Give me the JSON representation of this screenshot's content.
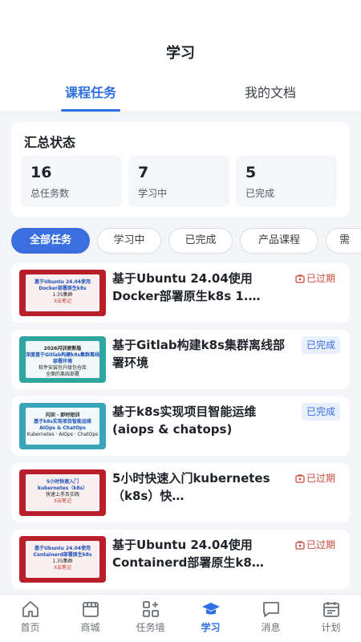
{
  "header": {
    "title": "学习",
    "tabs": [
      {
        "label": "课程任务",
        "active": true
      },
      {
        "label": "我的文档",
        "active": false
      }
    ]
  },
  "summary": {
    "title": "汇总状态",
    "stats": [
      {
        "value": "16",
        "label": "总任务数"
      },
      {
        "value": "7",
        "label": "学习中"
      },
      {
        "value": "5",
        "label": "已完成"
      }
    ]
  },
  "filters": {
    "chips": [
      "全部任务",
      "学习中",
      "已完成",
      "产品课程",
      "需"
    ],
    "active": "全部任务"
  },
  "courses": [
    {
      "title": "基于Ubuntu 24.04使用Docker部署原生k8s 1.…",
      "status": "已过期",
      "status_type": "expired",
      "thumb": {
        "line1": "基于Ubuntu 24.04使用",
        "line2": "Docker部署原生k8s",
        "line3": "1.35集群",
        "line4": "X云笔记",
        "bg": "#b81f2a"
      }
    },
    {
      "title": "基于Gitlab构建k8s集群离线部署环境",
      "status": "已完成",
      "status_type": "done",
      "thumb": {
        "line1": "2026闪训更新版",
        "line2": "深度基于Gitlab构建k8s集群离线部署环境",
        "line3": "软件安装包升级包仓库",
        "line4": "全面的离线部署",
        "bg": "#2fa7a0"
      }
    },
    {
      "title": "基于k8s实现项目智能运维(aiops & chatops)",
      "status": "已完成",
      "status_type": "done",
      "thumb": {
        "line1": "闪训 · 即时短训",
        "line2": "基于k8s实现项目智能运维",
        "line3": "AIOps & ChatOps",
        "line4": "Kubernetes · AIOps · ChatOps",
        "bg": "#3aa5b8"
      }
    },
    {
      "title": "5小时快速入门kubernetes（k8s）快…",
      "status": "已过期",
      "status_type": "expired",
      "thumb": {
        "line1": "5小时快速入门",
        "line2": "kubernetes（k8s）",
        "line3": "快速上手及实践",
        "line4": "X云笔记",
        "bg": "#b81f2a"
      }
    },
    {
      "title": "基于Ubuntu 24.04使用Containerd部署原生k8…",
      "status": "已过期",
      "status_type": "expired",
      "thumb": {
        "line1": "基于Ubuntu 24.04使用",
        "line2": "Containerd部署原生k8s",
        "line3": "1.35集群",
        "line4": "X云笔记",
        "bg": "#b81f2a"
      }
    }
  ],
  "bottom_nav": [
    {
      "label": "首页",
      "icon": "home-icon",
      "active": false
    },
    {
      "label": "商城",
      "icon": "store-icon",
      "active": false
    },
    {
      "label": "任务墙",
      "icon": "task-wall-icon",
      "active": false
    },
    {
      "label": "学习",
      "icon": "graduation-cap-icon",
      "active": true
    },
    {
      "label": "消息",
      "icon": "message-icon",
      "active": false
    },
    {
      "label": "计划",
      "icon": "calendar-icon",
      "active": false
    }
  ],
  "colors": {
    "accent": "#2f6fe4",
    "expired": "#c94a3b",
    "done_bg": "#e8effd"
  }
}
